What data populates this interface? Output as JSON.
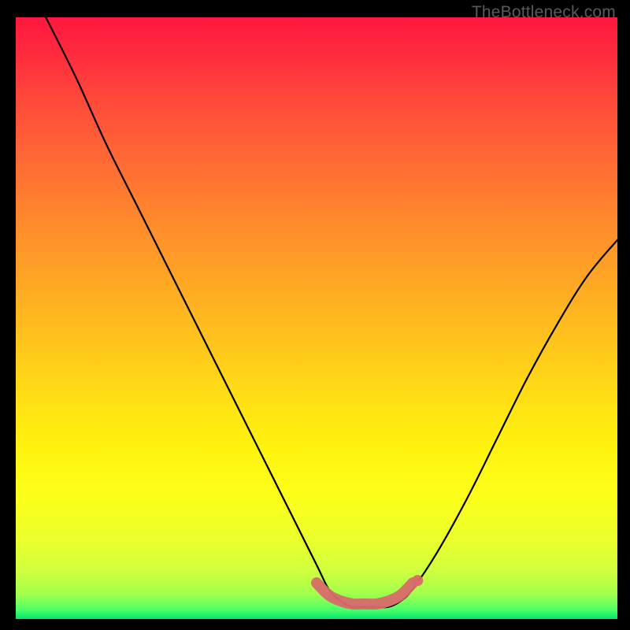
{
  "watermark": "TheBottleneck.com",
  "chart_data": {
    "type": "line",
    "title": "",
    "xlabel": "",
    "ylabel": "",
    "xlim": [
      0,
      100
    ],
    "ylim": [
      0,
      100
    ],
    "series": [
      {
        "name": "bottleneck-curve",
        "x": [
          5,
          10,
          15,
          20,
          25,
          30,
          35,
          40,
          45,
          50,
          52,
          54,
          56,
          58,
          60,
          62,
          64,
          66,
          70,
          75,
          80,
          85,
          90,
          95,
          100
        ],
        "values": [
          100,
          90,
          79,
          69,
          59,
          49,
          39,
          29,
          19,
          9,
          5,
          3,
          2,
          2,
          2,
          2,
          3,
          5,
          11,
          20,
          30,
          40,
          49,
          57,
          63
        ]
      }
    ],
    "highlight": {
      "name": "optimal-zone",
      "x": [
        50,
        52,
        54,
        56,
        58,
        60,
        62,
        64,
        66
      ],
      "values": [
        6,
        4,
        3,
        2.5,
        2.5,
        2.5,
        3,
        4,
        6
      ]
    }
  }
}
